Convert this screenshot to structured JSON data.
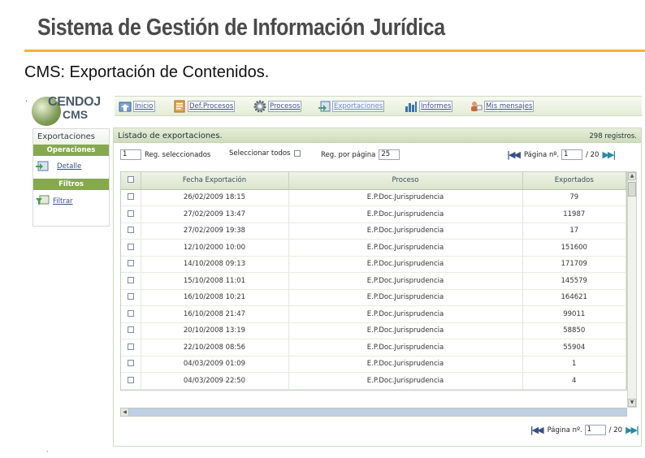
{
  "slide": {
    "title": "Sistema de Gestión de Información Jurídica",
    "subtitle": "CMS: Exportación de Contenidos.",
    "accent_color": "#f0b43a"
  },
  "logo": {
    "line1": "CENDOJ",
    "line2": "CMS"
  },
  "menu": [
    {
      "label": "Inicio",
      "icon": "home-icon",
      "active": false
    },
    {
      "label": "Def.Procesos",
      "icon": "process-definition-icon",
      "active": false
    },
    {
      "label": "Procesos",
      "icon": "gear-icon",
      "active": false
    },
    {
      "label": "Exportaciones",
      "icon": "export-icon",
      "active": true
    },
    {
      "label": "Informes",
      "icon": "bar-chart-icon",
      "active": false
    },
    {
      "label": "Mis mensajes",
      "icon": "messages-icon",
      "active": false
    }
  ],
  "sidebar": {
    "title": "Exportaciones",
    "operations_header": "Operaciones",
    "detail_label": "Detalle",
    "filters_header": "Filtros",
    "filter_label": "Filtrar"
  },
  "panel": {
    "title": "Listado de exportaciones.",
    "record_count": "298 registros."
  },
  "toolbar": {
    "selected_count": "1",
    "selected_label": "Reg. seleccionados",
    "select_all_label": "Seleccionar todos",
    "per_page_label": "Reg. por página",
    "per_page_value": "25",
    "page_label": "Página nº.",
    "page_value": "1",
    "total_pages": "/ 20"
  },
  "table": {
    "columns": [
      "Fecha Exportación",
      "Proceso",
      "Exportados"
    ],
    "rows": [
      [
        "26/02/2009 18:15",
        "E.P.Doc.Jurisprudencia",
        "79"
      ],
      [
        "27/02/2009 13:47",
        "E.P.Doc.Jurisprudencia",
        "11987"
      ],
      [
        "27/02/2009 19:38",
        "E.P.Doc.Jurisprudencia",
        "17"
      ],
      [
        "12/10/2000 10:00",
        "E.P.Doc.Jurisprudencia",
        "151600"
      ],
      [
        "14/10/2008 09:13",
        "E.P.Doc.Jurisprudencia",
        "171709"
      ],
      [
        "15/10/2008 11:01",
        "E.P.Doc.Jurisprudencia",
        "145579"
      ],
      [
        "16/10/2008 10:21",
        "E.P.Doc.Jurisprudencia",
        "164621"
      ],
      [
        "16/10/2008 21:47",
        "E.P.Doc.Jurisprudencia",
        "99011"
      ],
      [
        "20/10/2008 13:19",
        "E.P.Doc.Jurisprudencia",
        "58850"
      ],
      [
        "22/10/2008 08:56",
        "E.P.Doc.Jurisprudencia",
        "55904"
      ],
      [
        "04/03/2009 01:09",
        "E.P.Doc.Jurisprudencia",
        "1"
      ],
      [
        "04/03/2009 22:50",
        "E.P.Doc.Jurisprudencia",
        "4"
      ]
    ]
  }
}
